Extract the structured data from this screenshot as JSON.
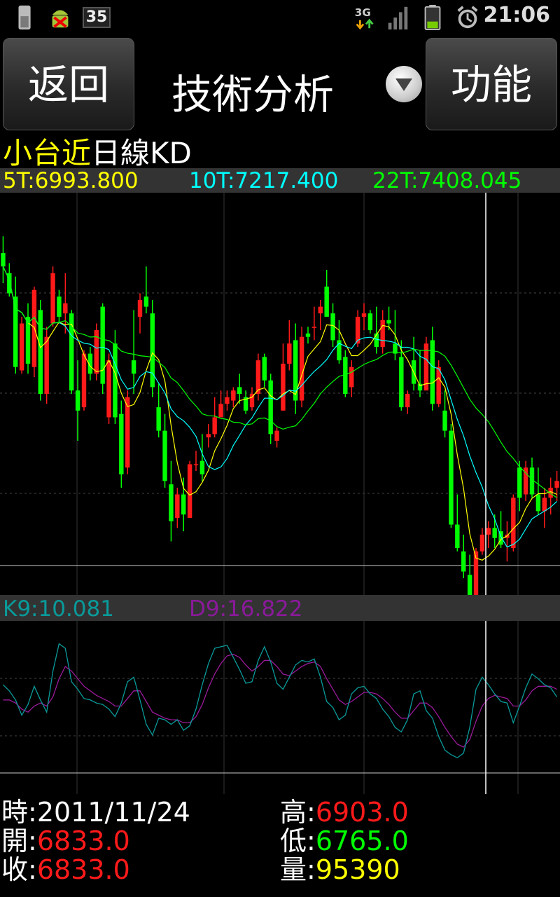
{
  "status_bar": {
    "notification_badge": "35",
    "time": "21:06",
    "network": "3G",
    "icons": [
      "battery-notification-icon",
      "android-debug-icon",
      "notification-count-icon",
      "3g-data-icon",
      "signal-icon",
      "battery-icon",
      "alarm-icon"
    ]
  },
  "toolbar": {
    "back_label": "返回",
    "title": "技術分析",
    "function_label": "功能",
    "dropdown_icon": "chevron-down-icon"
  },
  "chart_header": {
    "name": "小台近",
    "type": "日線KD"
  },
  "ma_legend": {
    "ma5": "5T:6993.800",
    "ma10": "10T:7217.400",
    "ma22": "22T:7408.045"
  },
  "kd_legend": {
    "k": "K9:10.081",
    "d": "D9:16.822"
  },
  "info": {
    "time_label": "時:",
    "time_value": "2011/11/24",
    "open_label": "開:",
    "open_value": "6833.0",
    "close_label": "收:",
    "close_value": "6833.0",
    "high_label": "高:",
    "high_value": "6903.0",
    "low_label": "低:",
    "low_value": "6765.0",
    "volume_label": "量:",
    "volume_value": "95390"
  },
  "colors": {
    "up": "#ff1a1a",
    "down": "#00ff00",
    "ma5": "#ffff00",
    "ma10": "#00ffff",
    "ma22": "#00ff00",
    "k_line": "#0a9a9a",
    "d_line": "#9a1a9a"
  },
  "chart_data": [
    {
      "type": "candlestick",
      "title": "小台近日線KD",
      "series": [
        {
          "name": "5T",
          "values": []
        },
        {
          "name": "10T",
          "values": []
        },
        {
          "name": "22T",
          "values": []
        }
      ],
      "candles": [
        [
          7420,
          7470,
          7330,
          7380
        ],
        [
          7360,
          7390,
          7290,
          7300
        ],
        [
          7290,
          7350,
          7060,
          7080
        ],
        [
          7070,
          7230,
          7060,
          7210
        ],
        [
          7230,
          7270,
          7060,
          7090
        ],
        [
          7080,
          7320,
          7050,
          7310
        ],
        [
          7250,
          7280,
          6980,
          7000
        ],
        [
          7000,
          7200,
          6970,
          7170
        ],
        [
          7210,
          7380,
          7200,
          7360
        ],
        [
          7290,
          7310,
          7210,
          7230
        ],
        [
          7240,
          7360,
          7180,
          7270
        ],
        [
          7240,
          7250,
          7000,
          7010
        ],
        [
          7010,
          7100,
          6860,
          6950
        ],
        [
          6960,
          7130,
          6950,
          7120
        ],
        [
          7120,
          7140,
          7040,
          7060
        ],
        [
          7060,
          7210,
          7040,
          7190
        ],
        [
          7260,
          7270,
          7000,
          7030
        ],
        [
          6930,
          7120,
          6910,
          7100
        ],
        [
          7150,
          7190,
          6910,
          6930
        ],
        [
          6940,
          6980,
          6720,
          6760
        ],
        [
          6780,
          7010,
          6760,
          6990
        ],
        [
          7100,
          7250,
          7000,
          7060
        ],
        [
          7230,
          7300,
          7180,
          7280
        ],
        [
          7290,
          7380,
          7240,
          7260
        ],
        [
          7240,
          7280,
          6990,
          7020
        ],
        [
          6960,
          7030,
          6870,
          6890
        ],
        [
          6890,
          6940,
          6720,
          6740
        ],
        [
          6730,
          6800,
          6560,
          6620
        ],
        [
          6630,
          6720,
          6600,
          6700
        ],
        [
          6700,
          6750,
          6590,
          6640
        ],
        [
          6630,
          6800,
          6630,
          6790
        ],
        [
          6790,
          6830,
          6770,
          6790
        ],
        [
          6800,
          6880,
          6740,
          6760
        ],
        [
          6870,
          6910,
          6840,
          6880
        ],
        [
          6880,
          6990,
          6870,
          6930
        ],
        [
          6930,
          7010,
          6930,
          6970
        ],
        [
          6970,
          7010,
          6950,
          6990
        ],
        [
          6980,
          7020,
          6960,
          7010
        ],
        [
          7020,
          7060,
          6970,
          7000
        ],
        [
          6990,
          7010,
          6940,
          6950
        ],
        [
          6960,
          7020,
          6950,
          7000
        ],
        [
          7000,
          7120,
          6980,
          7100
        ],
        [
          7110,
          7120,
          7020,
          7040
        ],
        [
          7040,
          7060,
          6850,
          6880
        ],
        [
          6860,
          6900,
          6840,
          6890
        ],
        [
          6950,
          7150,
          6950,
          7090
        ],
        [
          7090,
          7220,
          7070,
          7150
        ],
        [
          7160,
          7210,
          6940,
          6980
        ],
        [
          6980,
          7200,
          6960,
          7170
        ],
        [
          7180,
          7200,
          7150,
          7170
        ],
        [
          7200,
          7260,
          7160,
          7200
        ],
        [
          7240,
          7280,
          7190,
          7260
        ],
        [
          7320,
          7370,
          7230,
          7230
        ],
        [
          7240,
          7270,
          7140,
          7160
        ],
        [
          7160,
          7220,
          7090,
          7100
        ],
        [
          7110,
          7130,
          6990,
          7000
        ],
        [
          7020,
          7100,
          6990,
          7080
        ],
        [
          7150,
          7250,
          7140,
          7230
        ],
        [
          7230,
          7270,
          7190,
          7240
        ],
        [
          7240,
          7250,
          7180,
          7190
        ],
        [
          7180,
          7260,
          7120,
          7140
        ],
        [
          7140,
          7250,
          7120,
          7220
        ],
        [
          7220,
          7260,
          7190,
          7210
        ],
        [
          7150,
          7250,
          7100,
          7120
        ],
        [
          7110,
          7160,
          6950,
          6960
        ],
        [
          6960,
          7010,
          6940,
          7000
        ],
        [
          7100,
          7170,
          7010,
          7030
        ],
        [
          7030,
          7130,
          6990,
          7010
        ],
        [
          7010,
          7170,
          7010,
          7150
        ],
        [
          7160,
          7200,
          6950,
          6970
        ],
        [
          6970,
          7100,
          6960,
          7080
        ],
        [
          6950,
          7010,
          6870,
          6890
        ],
        [
          6890,
          6910,
          6600,
          6610
        ],
        [
          6610,
          6700,
          6530,
          6540
        ],
        [
          6530,
          6580,
          6450,
          6470
        ],
        [
          6460,
          6520,
          6390,
          6400
        ],
        [
          6400,
          6540,
          6370,
          6530
        ],
        [
          6530,
          6600,
          6520,
          6580
        ],
        [
          6580,
          6620,
          6540,
          6600
        ],
        [
          6600,
          6640,
          6540,
          6570
        ],
        [
          6590,
          6650,
          6540,
          6550
        ],
        [
          6570,
          6620,
          6500,
          6580
        ],
        [
          6540,
          6700,
          6530,
          6690
        ],
        [
          6780,
          6800,
          6650,
          6690
        ],
        [
          6700,
          6800,
          6680,
          6780
        ],
        [
          6780,
          6810,
          6690,
          6700
        ],
        [
          6700,
          6780,
          6640,
          6650
        ],
        [
          6650,
          6720,
          6600,
          6690
        ],
        [
          6690,
          6750,
          6640,
          6720
        ],
        [
          6720,
          6770,
          6680,
          6740
        ]
      ],
      "ylim": [
        6400,
        7600
      ]
    },
    {
      "type": "line",
      "title": "KD",
      "series": [
        {
          "name": "K9",
          "values": [
            58,
            54,
            48,
            38,
            45,
            57,
            48,
            40,
            67,
            85,
            82,
            60,
            55,
            49,
            48,
            46,
            45,
            42,
            37,
            46,
            60,
            63,
            48,
            32,
            25,
            36,
            35,
            32,
            35,
            28,
            31,
            42,
            58,
            72,
            82,
            83,
            84,
            76,
            68,
            59,
            60,
            74,
            83,
            73,
            59,
            55,
            63,
            71,
            74,
            73,
            75,
            63,
            47,
            43,
            35,
            38,
            52,
            56,
            57,
            52,
            49,
            42,
            37,
            30,
            27,
            35,
            52,
            54,
            41,
            36,
            24,
            15,
            12,
            10,
            13,
            30,
            55,
            63,
            58,
            52,
            47,
            46,
            33,
            44,
            56,
            65,
            62,
            58,
            56,
            50
          ]
        },
        {
          "name": "D9",
          "values": [
            48,
            48,
            46,
            42,
            40,
            44,
            46,
            44,
            50,
            62,
            70,
            67,
            62,
            57,
            54,
            51,
            49,
            47,
            44,
            44,
            49,
            54,
            54,
            47,
            40,
            38,
            36,
            35,
            35,
            33,
            33,
            37,
            45,
            56,
            65,
            72,
            77,
            78,
            76,
            71,
            67,
            70,
            74,
            74,
            70,
            65,
            64,
            67,
            70,
            72,
            73,
            70,
            62,
            55,
            48,
            45,
            47,
            50,
            53,
            53,
            52,
            49,
            45,
            40,
            36,
            36,
            41,
            46,
            46,
            43,
            37,
            30,
            24,
            19,
            17,
            22,
            34,
            44,
            49,
            51,
            50,
            49,
            44,
            44,
            48,
            54,
            57,
            57,
            57,
            55
          ]
        }
      ],
      "ylim": [
        0,
        100
      ]
    }
  ]
}
